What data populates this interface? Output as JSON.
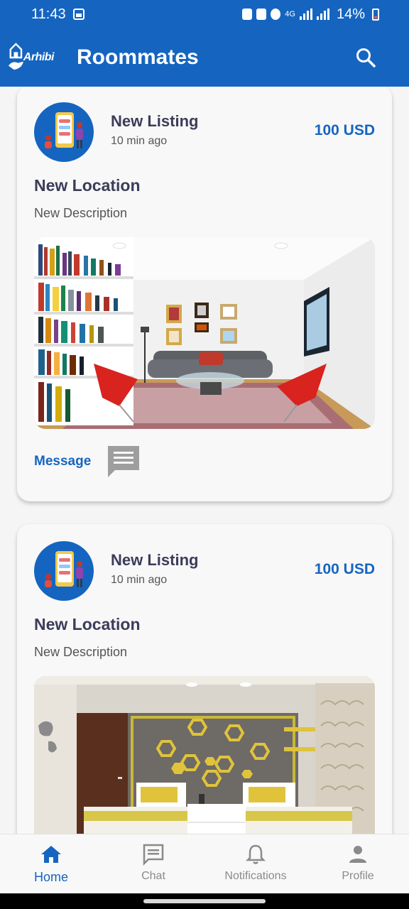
{
  "status_bar": {
    "time": "11:43",
    "network": "4G",
    "battery_percent": "14%"
  },
  "app_bar": {
    "logo_text": "Arhibi",
    "title": "Roommates",
    "search_icon": "search-icon"
  },
  "listings": [
    {
      "poster": "New Listing",
      "time_ago": "10 min ago",
      "price": "100 USD",
      "location": "New Location",
      "description": "New Description",
      "message_label": "Message",
      "photo": "living-room-photo"
    },
    {
      "poster": "New Listing",
      "time_ago": "10 min ago",
      "price": "100 USD",
      "location": "New Location",
      "description": "New Description",
      "photo": "bedroom-photo"
    }
  ],
  "bottom_nav": {
    "items": [
      {
        "label": "Home",
        "icon": "home-icon",
        "active": true
      },
      {
        "label": "Chat",
        "icon": "chat-icon",
        "active": false
      },
      {
        "label": "Notifications",
        "icon": "bell-icon",
        "active": false
      },
      {
        "label": "Profile",
        "icon": "person-icon",
        "active": false
      }
    ]
  },
  "colors": {
    "primary": "#1565c0",
    "title_text": "#3c3c5a",
    "inactive_nav": "#8a8a8a"
  }
}
